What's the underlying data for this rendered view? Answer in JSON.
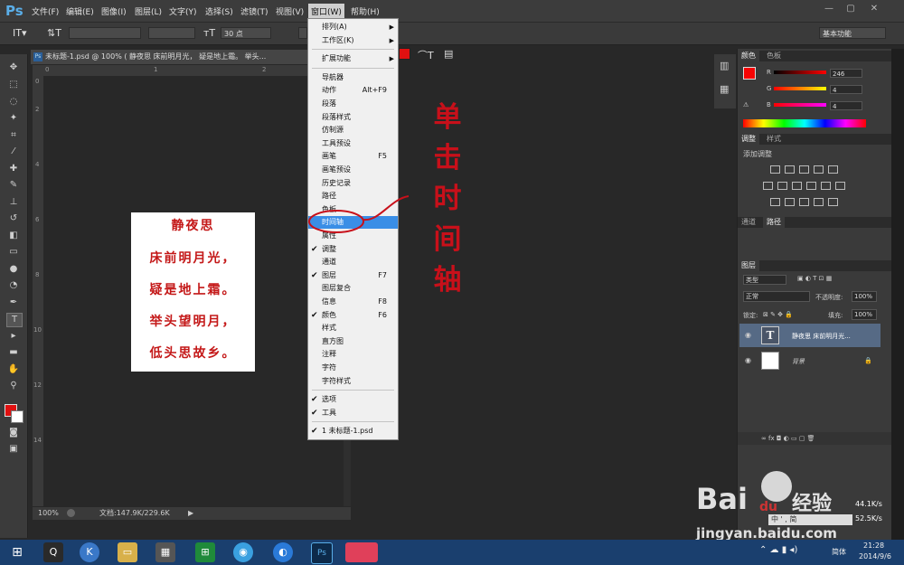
{
  "app": {
    "logo": "Ps"
  },
  "menubar": {
    "items": [
      "文件(F)",
      "编辑(E)",
      "图像(I)",
      "图层(L)",
      "文字(Y)",
      "选择(S)",
      "滤镜(T)",
      "视图(V)",
      "窗口(W)",
      "帮助(H)"
    ],
    "active": "窗口(W)"
  },
  "window_controls": {
    "minimize": "—",
    "maximize": "▢",
    "close": "✕"
  },
  "options": {
    "font_size": "30 点",
    "workspace": "基本功能"
  },
  "document": {
    "tab_title": "未标题-1.psd @ 100% (   静夜思 床前明月光， 疑是地上霜。 举头...",
    "zoom": "100%",
    "doc_size": "文档:147.9K/229.6K",
    "poem": [
      "静夜思",
      "床前明月光，",
      "疑是地上霜。",
      "举头望明月，",
      "低头思故乡。"
    ],
    "ruler_h": [
      "0",
      "1",
      "2"
    ],
    "ruler_v": [
      "0",
      "2",
      "4",
      "6",
      "8",
      "10",
      "12",
      "14"
    ]
  },
  "window_menu": {
    "items": [
      {
        "label": "排列(A)",
        "submenu": true
      },
      {
        "label": "工作区(K)",
        "submenu": true
      },
      {
        "sep": true
      },
      {
        "label": "扩展功能",
        "submenu": true
      },
      {
        "sep": true
      },
      {
        "label": "导航器"
      },
      {
        "label": "动作",
        "shortcut": "Alt+F9"
      },
      {
        "label": "段落"
      },
      {
        "label": "段落样式"
      },
      {
        "label": "仿制源"
      },
      {
        "label": "工具预设"
      },
      {
        "label": "画笔",
        "shortcut": "F5"
      },
      {
        "label": "画笔预设"
      },
      {
        "label": "历史记录"
      },
      {
        "label": "路径"
      },
      {
        "label": "色板"
      },
      {
        "label": "时间轴",
        "highlighted": true
      },
      {
        "label": "属性"
      },
      {
        "label": "调整",
        "checked": true
      },
      {
        "label": "通道"
      },
      {
        "label": "图层",
        "shortcut": "F7",
        "checked": true
      },
      {
        "label": "图层复合"
      },
      {
        "label": "信息",
        "shortcut": "F8"
      },
      {
        "label": "颜色",
        "shortcut": "F6",
        "checked": true
      },
      {
        "label": "样式"
      },
      {
        "label": "直方图"
      },
      {
        "label": "注释"
      },
      {
        "label": "字符"
      },
      {
        "label": "字符样式"
      },
      {
        "sep": true
      },
      {
        "label": "选项",
        "checked": true
      },
      {
        "label": "工具",
        "checked": true
      },
      {
        "sep": true
      },
      {
        "label": "1 未标题-1.psd",
        "checked": true
      }
    ]
  },
  "annotation": {
    "chars": [
      "单",
      "击",
      "时",
      "间",
      "轴"
    ],
    "color": "#c8101a"
  },
  "panels": {
    "color": {
      "tabs": [
        "颜色",
        "色板"
      ],
      "r": "246",
      "g": "4",
      "b": "4",
      "r_label": "R",
      "g_label": "G",
      "b_label": "B",
      "swatch": "#f60404"
    },
    "adjust": {
      "tabs": [
        "调整",
        "样式"
      ],
      "title": "添加调整"
    },
    "paths": {
      "tabs": [
        "通道",
        "路径"
      ]
    },
    "layers": {
      "tab": "图层",
      "filter": "类型",
      "blend": "正常",
      "opacity_label": "不透明度:",
      "opacity": "100%",
      "lock_label": "锁定:",
      "fill_label": "填充:",
      "fill": "100%",
      "rows": [
        {
          "name": "静夜思 床前明月光...",
          "thumb": "T",
          "selected": true
        },
        {
          "name": "背景",
          "thumb": "",
          "selected": false
        }
      ]
    }
  },
  "watermark": {
    "brand": "Bai",
    "du": "du",
    "jingyan": "经验",
    "url": "jingyan.baidu.com"
  },
  "net_speed": {
    "up": "44.1K/s",
    "down": "52.5K/s"
  },
  "taskbar": {
    "time": "21:28",
    "date": "2014/9/6",
    "ime": "简体",
    "ime_tray": "中 ' , 简"
  }
}
